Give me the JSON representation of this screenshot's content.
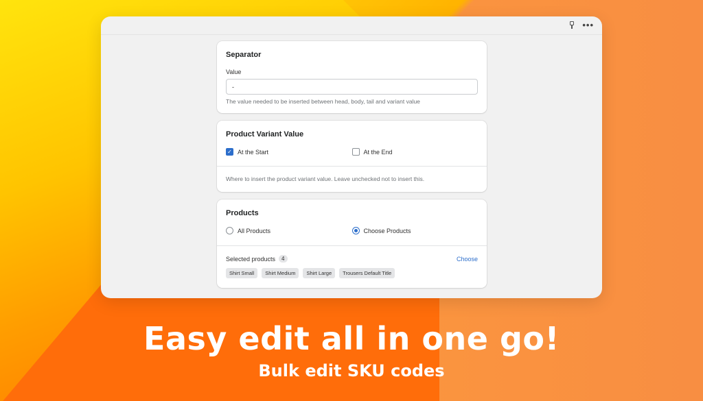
{
  "separator": {
    "title": "Separator",
    "value_label": "Value",
    "value": "-",
    "help": "The value needed to be inserted between head, body, tail and variant value"
  },
  "variant": {
    "title": "Product Variant Value",
    "at_start_label": "At the Start",
    "at_start_checked": true,
    "at_end_label": "At the End",
    "at_end_checked": false,
    "help": "Where to insert the product variant value. Leave unchecked not to insert this."
  },
  "products": {
    "title": "Products",
    "all_label": "All Products",
    "choose_products_label": "Choose Products",
    "selected_option": "Choose Products",
    "selected_label": "Selected products",
    "selected_count": "4",
    "choose_link": "Choose",
    "tags": [
      "Shirt Small",
      "Shirt Medium",
      "Shirt Large",
      "Trousers Default Title"
    ]
  },
  "promo": {
    "headline": "Easy edit all in one go!",
    "subline": "Bulk edit SKU codes"
  },
  "colors": {
    "accent": "#2c6ecb",
    "background_yellow": "#ffe21a",
    "background_orange": "#f88e42"
  }
}
